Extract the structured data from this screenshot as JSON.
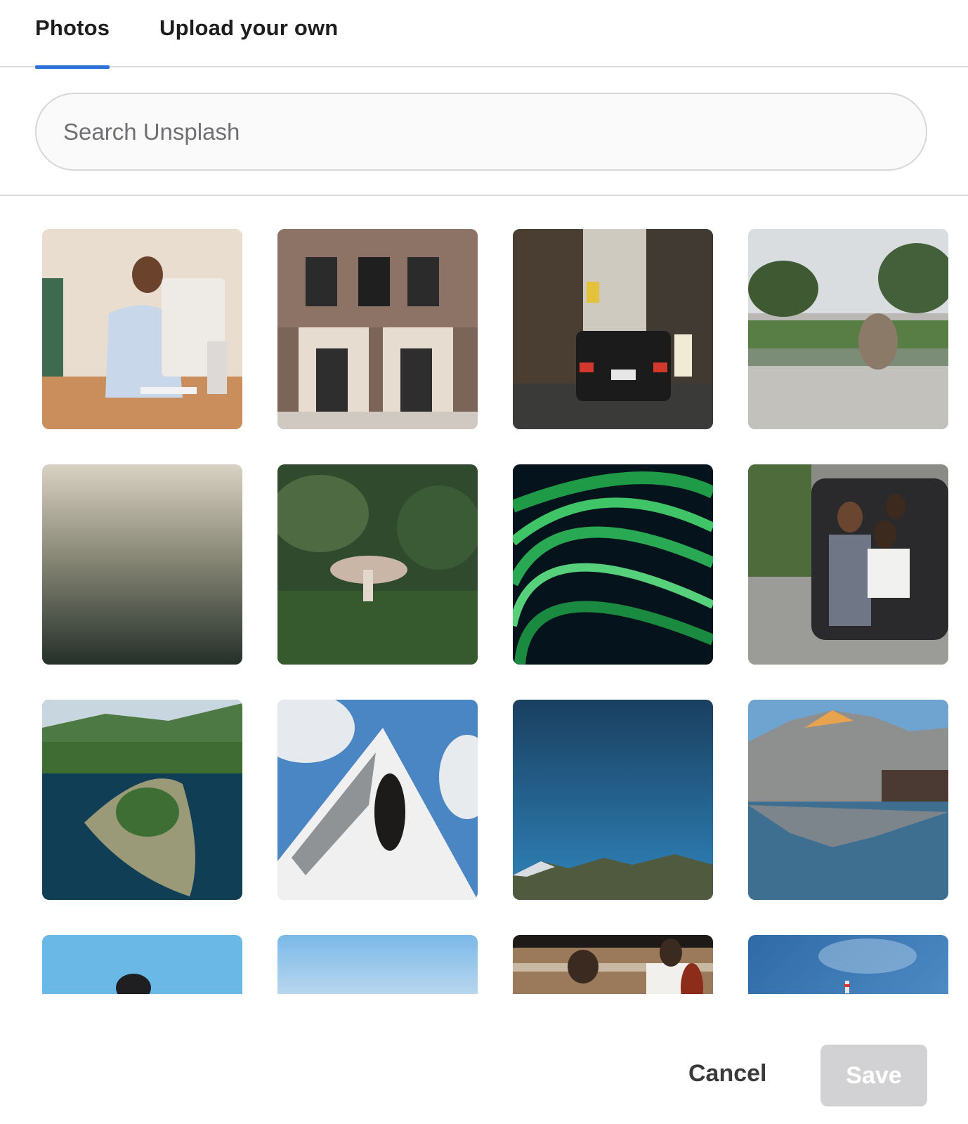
{
  "tabs": {
    "photos_label": "Photos",
    "upload_label": "Upload your own",
    "active": "photos"
  },
  "search": {
    "placeholder": "Search Unsplash",
    "value": ""
  },
  "photos": [
    {
      "subject": "woman at desktop computer"
    },
    {
      "subject": "townhouse facade with doors"
    },
    {
      "subject": "taxi in narrow street"
    },
    {
      "subject": "skateboarder in park"
    },
    {
      "subject": "foggy forest aerial"
    },
    {
      "subject": "mushroom in forest"
    },
    {
      "subject": "green light trails"
    },
    {
      "subject": "family selfie in car trunk"
    },
    {
      "subject": "island in lake aerial"
    },
    {
      "subject": "woman by white building"
    },
    {
      "subject": "starry sky over mountains"
    },
    {
      "subject": "mountain reflected in lake"
    },
    {
      "subject": "person against blue sky"
    },
    {
      "subject": "pastel sky horizon"
    },
    {
      "subject": "musicians with cello"
    },
    {
      "subject": "blue sky with lighthouse"
    }
  ],
  "footer": {
    "cancel_label": "Cancel",
    "save_label": "Save",
    "save_enabled": false
  },
  "colors": {
    "tab_indicator": "#2a72d9",
    "save_disabled_bg": "#d2d2d4"
  }
}
